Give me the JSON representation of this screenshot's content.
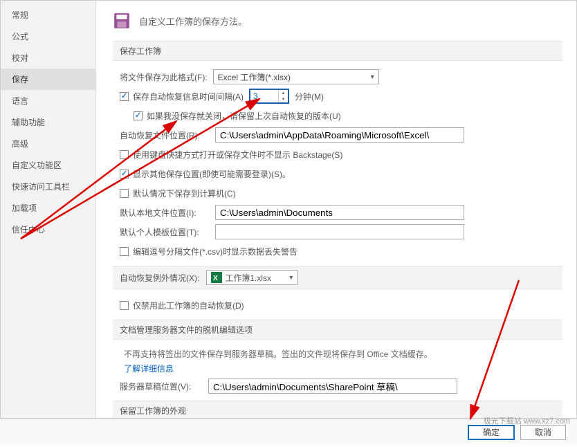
{
  "sidebar": {
    "items": [
      {
        "label": "常规"
      },
      {
        "label": "公式"
      },
      {
        "label": "校对"
      },
      {
        "label": "保存",
        "selected": true
      },
      {
        "label": "语言"
      },
      {
        "label": "辅助功能"
      },
      {
        "label": "高级"
      },
      {
        "label": "自定义功能区"
      },
      {
        "label": "快速访问工具栏"
      },
      {
        "label": "加载项"
      },
      {
        "label": "信任中心"
      }
    ]
  },
  "header": {
    "title": "自定义工作簿的保存方法。"
  },
  "sections": {
    "save_workbook": "保存工作簿",
    "autorecover_exceptions": "自动恢复例外情况(X):",
    "doc_mgmt": "文档管理服务器文件的脱机编辑选项",
    "preserve_look": "保留工作簿的外观"
  },
  "fields": {
    "save_format_label": "将文件保存为此格式(F):",
    "save_format_value": "Excel 工作簿(*.xlsx)",
    "autorecover_check": "保存自动恢复信息时间间隔(A)",
    "autorecover_value": "3",
    "minutes_label": "分钟(M)",
    "keep_last_label": "如果我没保存就关闭，请保留上次自动恢复的版本(U)",
    "autorecover_path_label": "自动恢复文件位置(R):",
    "autorecover_path": "C:\\Users\\admin\\AppData\\Roaming\\Microsoft\\Excel\\",
    "backstage_label": "使用键盘快捷方式打开或保存文件时不显示 Backstage(S)",
    "show_other_label": "显示其他保存位置(即使可能需要登录)(S)。",
    "default_computer_label": "默认情况下保存到计算机(C)",
    "default_local_label": "默认本地文件位置(I):",
    "default_local_path": "C:\\Users\\admin\\Documents",
    "default_template_label": "默认个人模板位置(T):",
    "default_template_path": "",
    "csv_warning_label": "编辑逗号分隔文件(*.csv)时显示数据丢失警告",
    "exception_workbook": "工作簿1.xlsx",
    "disable_autorecover_label": "仅禁用此工作簿的自动恢复(D)",
    "doc_mgmt_text": "不再支持将签出的文件保存到服务器草稿。签出的文件现将保存到 Office 文档缓存。",
    "learn_more": "了解详细信息",
    "server_draft_label": "服务器草稿位置(V):",
    "server_draft_path": "C:\\Users\\admin\\Documents\\SharePoint 草稿\\"
  },
  "footer": {
    "ok": "确定",
    "cancel": "取消"
  },
  "watermark": "极光下载站 www.xz7.com"
}
